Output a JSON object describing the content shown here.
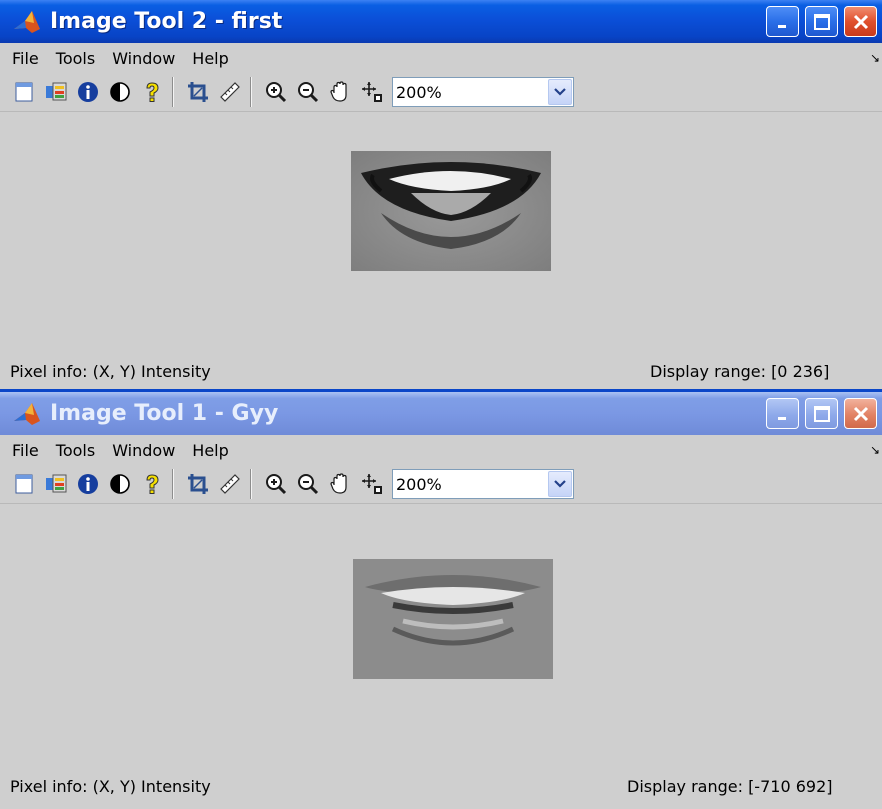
{
  "windows": [
    {
      "title": "Image Tool 2 - first",
      "active": true,
      "menu": [
        "File",
        "Tools",
        "Window",
        "Help"
      ],
      "zoom": "200%",
      "status": {
        "pixel_info": "Pixel info: (X, Y)  Intensity",
        "display_range": "Display range: [0 236]"
      }
    },
    {
      "title": "Image Tool 1 - Gyy",
      "active": false,
      "menu": [
        "File",
        "Tools",
        "Window",
        "Help"
      ],
      "zoom": "200%",
      "status": {
        "pixel_info": "Pixel info: (X, Y)  Intensity",
        "display_range": "Display range: [-710 692]"
      }
    }
  ],
  "toolbar_icons": [
    "new-figure-icon",
    "export-to-workspace-icon",
    "image-information-icon",
    "adjust-contrast-icon",
    "help-icon",
    "crop-icon",
    "measure-distance-icon",
    "zoom-in-icon",
    "zoom-out-icon",
    "pan-icon",
    "pixel-region-icon"
  ],
  "colors": {
    "title_active": "#0b4fd8",
    "title_inactive": "#7b98e4",
    "background": "#cfcfcf"
  }
}
